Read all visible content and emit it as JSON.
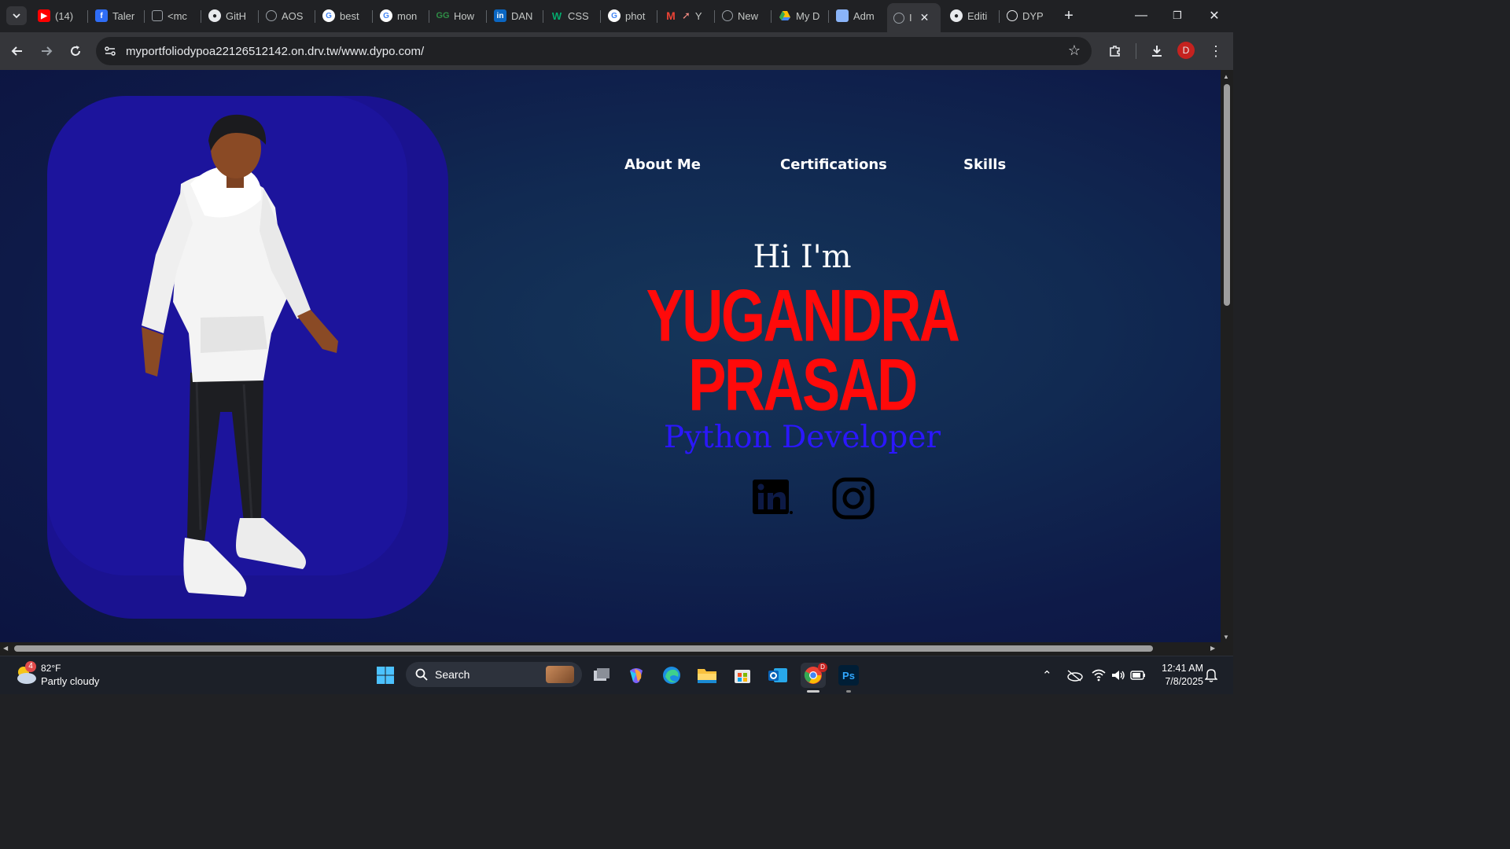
{
  "browser": {
    "tabs": [
      {
        "label": "(14)",
        "icon": "youtube-icon"
      },
      {
        "label": "Taler",
        "icon": "app-icon"
      },
      {
        "label": "<mc",
        "icon": "cube-icon"
      },
      {
        "label": "GitH",
        "icon": "github-icon"
      },
      {
        "label": "AOS",
        "icon": "globe-icon"
      },
      {
        "label": "best",
        "icon": "google-icon"
      },
      {
        "label": "mon",
        "icon": "google-icon"
      },
      {
        "label": "How",
        "icon": "geeksforgeeks-icon"
      },
      {
        "label": "DAN",
        "icon": "linkedin-icon"
      },
      {
        "label": "CSS",
        "icon": "w3schools-icon"
      },
      {
        "label": "phot",
        "icon": "google-icon"
      },
      {
        "label": "Y",
        "icon": "gmail-icon"
      },
      {
        "label": "New",
        "icon": "globe-icon"
      },
      {
        "label": "My D",
        "icon": "drive-icon"
      },
      {
        "label": "Adm",
        "icon": "admin-icon"
      },
      {
        "label": "I",
        "icon": "globe-icon",
        "active": true
      },
      {
        "label": "Editi",
        "icon": "github-icon"
      },
      {
        "label": "DYP",
        "icon": "openai-icon"
      }
    ],
    "url": "myportfoliodypoa22126512142.on.drv.tw/www.dypo.com/",
    "profile_initial": "D"
  },
  "page": {
    "nav": [
      "About Me",
      "Certifications",
      "Skills"
    ],
    "greeting": "Hi I'm",
    "name_line1": "YUGANDRA",
    "name_line2": "PRASAD",
    "role": "Python Developer",
    "social": [
      "linkedin-icon",
      "instagram-icon"
    ],
    "colors": {
      "name": "#ff0a0a",
      "role": "#2b17ff",
      "card": "#1c149c"
    }
  },
  "taskbar": {
    "weather_temp": "82°F",
    "weather_desc": "Partly cloudy",
    "weather_badge": "4",
    "search_label": "Search",
    "time": "12:41 AM",
    "date": "7/8/2025"
  }
}
